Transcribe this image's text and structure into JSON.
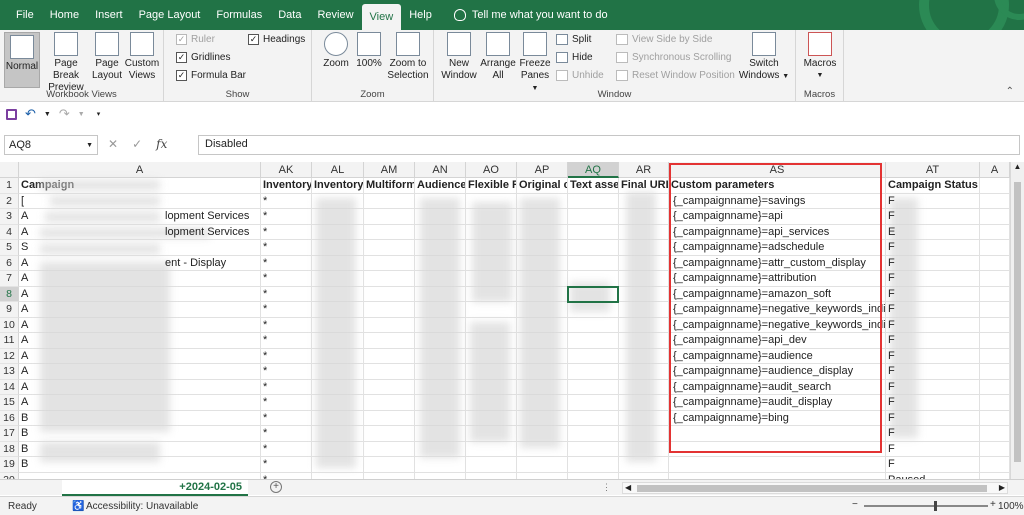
{
  "ribbon_tabs": [
    "File",
    "Home",
    "Insert",
    "Page Layout",
    "Formulas",
    "Data",
    "Review",
    "View",
    "Help"
  ],
  "tell_me": "Tell me what you want to do",
  "groups": {
    "workbook_views": {
      "label": "Workbook Views",
      "normal": "Normal",
      "page_break_1": "Page Break",
      "page_break_2": "Preview",
      "page_layout_1": "Page",
      "page_layout_2": "Layout",
      "custom_1": "Custom",
      "custom_2": "Views"
    },
    "show": {
      "label": "Show",
      "ruler": "Ruler",
      "gridlines": "Gridlines",
      "formula_bar": "Formula Bar",
      "headings": "Headings"
    },
    "zoom": {
      "label": "Zoom",
      "zoom": "Zoom",
      "pct": "100%",
      "sel_1": "Zoom to",
      "sel_2": "Selection"
    },
    "window": {
      "label": "Window",
      "new_1": "New",
      "new_2": "Window",
      "arrange_1": "Arrange",
      "arrange_2": "All",
      "freeze_1": "Freeze",
      "freeze_2": "Panes",
      "split": "Split",
      "hide": "Hide",
      "unhide": "Unhide",
      "side": "View Side by Side",
      "sync": "Synchronous Scrolling",
      "reset": "Reset Window Position",
      "switch_1": "Switch",
      "switch_2": "Windows"
    },
    "macros": {
      "label": "Macros",
      "macros": "Macros"
    }
  },
  "name_box": "AQ8",
  "formula_value": "Disabled",
  "fx": "fx",
  "columns": [
    "A",
    "AK",
    "AL",
    "AM",
    "AN",
    "AO",
    "AP",
    "AQ",
    "AR",
    "AS",
    "AT",
    "A"
  ],
  "rows": [
    "1",
    "2",
    "3",
    "4",
    "5",
    "6",
    "7",
    "8",
    "9",
    "10",
    "11",
    "12",
    "13",
    "14",
    "15",
    "16",
    "17",
    "18",
    "19",
    "20"
  ],
  "header_row": {
    "A": "Campaign",
    "AK": "Inventory",
    "AL": "Inventory",
    "AM": "Multiform",
    "AN": "Audience",
    "AO": "Flexible Re",
    "AP": "Original ca",
    "AQ": "Text asset",
    "AR": "Final URL",
    "AS": "Custom parameters",
    "AT": "Campaign Status"
  },
  "col_a": [
    "[",
    "A",
    "A",
    "S",
    "A",
    "A",
    "A",
    "A",
    "A",
    "A",
    "A",
    "A",
    "A",
    "A",
    "B",
    "B",
    "B",
    "B"
  ],
  "col_a_partial": [
    "",
    "lopment Services",
    "lopment Services",
    "",
    "ent - Display"
  ],
  "col_ak": [
    "*",
    "*",
    "*",
    "*",
    "*",
    "*",
    "*",
    "*",
    "*",
    "*",
    "*",
    "*",
    "*",
    "*",
    "*",
    "*",
    "*",
    "*",
    "*"
  ],
  "custom_params": [
    "{_campaignname}=savings",
    "{_campaignname}=api",
    "{_campaignname}=api_services",
    "{_campaignname}=adschedule",
    "{_campaignname}=attr_custom_display",
    "{_campaignname}=attribution",
    "{_campaignname}=amazon_soft",
    "{_campaignname}=negative_keywords_india",
    "{_campaignname}=negative_keywords_india",
    "{_campaignname}=api_dev",
    "{_campaignname}=audience",
    "{_campaignname}=audience_display",
    "{_campaignname}=audit_search",
    "{_campaignname}=audit_display",
    "{_campaignname}=bing"
  ],
  "col_at": [
    "F",
    "F",
    "E",
    "F",
    "F",
    "F",
    "F",
    "F",
    "F",
    "F",
    "F",
    "F",
    "F",
    "F",
    "F",
    "F",
    "F",
    "F"
  ],
  "col_at_last": "Paused",
  "sheet_tab": "+2024-02-05",
  "status": {
    "ready": "Ready",
    "accessibility": "Accessibility: Unavailable",
    "zoom": "100%"
  },
  "accent": "#217346",
  "highlight": "#e33333"
}
